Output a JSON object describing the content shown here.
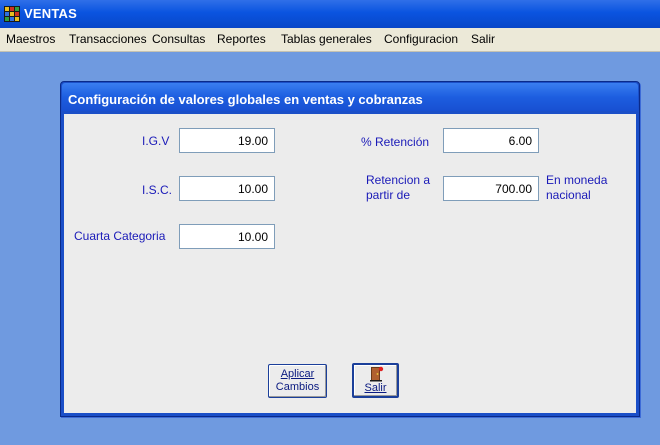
{
  "window": {
    "title": "VENTAS",
    "icon": "app-grid-icon"
  },
  "menu": [
    "Maestros",
    "Transacciones",
    "Consultas",
    "Reportes",
    "Tablas generales",
    "Configuracion",
    "Salir"
  ],
  "dialog": {
    "title": "Configuración de valores globales en ventas y cobranzas",
    "fields": {
      "igv": {
        "label": "I.G.V",
        "value": "19.00"
      },
      "isc": {
        "label": "I.S.C.",
        "value": "10.00"
      },
      "cuarta": {
        "label": "Cuarta Categoria",
        "value": "10.00"
      },
      "retencion": {
        "label": "% Retención",
        "value": "6.00"
      },
      "retencion_partir": {
        "label_line1": "Retencion a",
        "label_line2": "partir de",
        "value": "700.00",
        "suffix_line1": "En moneda",
        "suffix_line2": "nacional"
      }
    },
    "buttons": {
      "aplicar": {
        "line1": "Aplicar",
        "line2": "Cambios"
      },
      "salir": {
        "label": "Salir",
        "icon": "exit-door-icon"
      }
    }
  },
  "colors": {
    "desktop": "#6f9ae0",
    "titlebar": "#0a54e0",
    "menubar": "#ece9d8",
    "dialog_body": "#ececec",
    "label": "#1a1ab8"
  }
}
